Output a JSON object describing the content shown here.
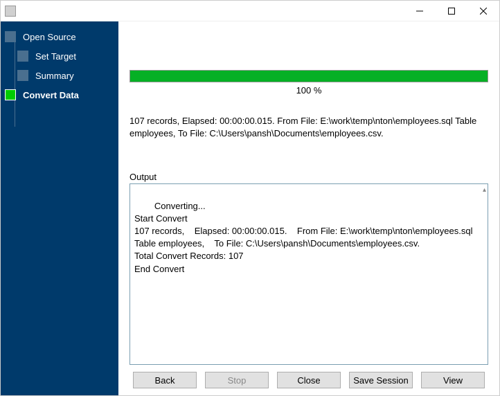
{
  "sidebar": {
    "items": [
      {
        "label": "Open Source"
      },
      {
        "label": "Set Target"
      },
      {
        "label": "Summary"
      },
      {
        "label": "Convert Data"
      }
    ]
  },
  "progress": {
    "percent": 100,
    "label": "100 %"
  },
  "status": "107 records,    Elapsed: 00:00:00.015.    From File: E:\\work\\temp\\nton\\employees.sql Table employees,    To File: C:\\Users\\pansh\\Documents\\employees.csv.",
  "output_label": "Output",
  "output_text": "Converting...\nStart Convert\n107 records,    Elapsed: 00:00:00.015.    From File: E:\\work\\temp\\nton\\employees.sql Table employees,    To File: C:\\Users\\pansh\\Documents\\employees.csv.\nTotal Convert Records: 107\nEnd Convert\n",
  "buttons": {
    "back": "Back",
    "stop": "Stop",
    "close": "Close",
    "save_session": "Save Session",
    "view": "View"
  }
}
